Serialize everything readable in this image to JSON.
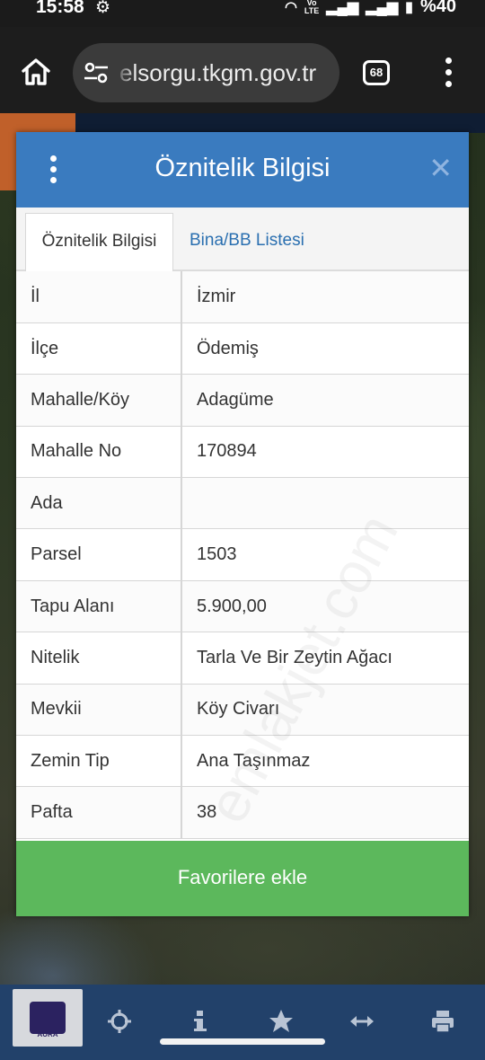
{
  "status": {
    "time": "15:58",
    "battery": "%40",
    "network": "Vo LTE1 LTE2"
  },
  "browser": {
    "url": "elsorgu.tkgm.gov.tr",
    "tab_count": "68"
  },
  "dialog": {
    "title": "Öznitelik Bilgisi",
    "tabs": [
      {
        "label": "Öznitelik Bilgisi",
        "active": true
      },
      {
        "label": "Bina/BB Listesi",
        "active": false
      }
    ],
    "rows": [
      {
        "key": "İl",
        "value": "İzmir"
      },
      {
        "key": "İlçe",
        "value": "Ödemiş"
      },
      {
        "key": "Mahalle/Köy",
        "value": "Adagüme"
      },
      {
        "key": "Mahalle No",
        "value": "170894"
      },
      {
        "key": "Ada",
        "value": ""
      },
      {
        "key": "Parsel",
        "value": "1503"
      },
      {
        "key": "Tapu Alanı",
        "value": "5.900,00"
      },
      {
        "key": "Nitelik",
        "value": "Tarla Ve Bir Zeytin Ağacı"
      },
      {
        "key": "Mevkii",
        "value": "Köy Civarı"
      },
      {
        "key": "Zemin Tip",
        "value": "Ana Taşınmaz"
      },
      {
        "key": "Pafta",
        "value": "38"
      }
    ],
    "favorite_button": "Favorilere ekle"
  },
  "watermark": "emlakjet.com",
  "toolbar": {
    "logo_text": "AURA",
    "tools": [
      "crosshair-icon",
      "info-icon",
      "star-icon",
      "measure-icon",
      "print-icon"
    ]
  },
  "colors": {
    "header": "#3a7bbf",
    "favorite": "#5cb85c",
    "toolbar": "#22416a"
  }
}
